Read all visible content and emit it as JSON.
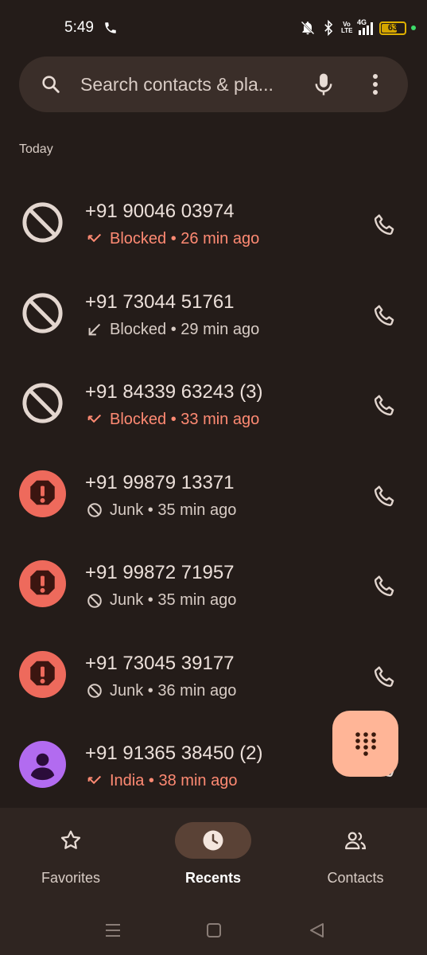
{
  "status_bar": {
    "time": "5:49",
    "volte_line1": "Vo",
    "volte_line2": "LTE",
    "network": "4G",
    "battery": "63",
    "battery_level": 0.63
  },
  "search": {
    "placeholder": "Search contacts & pla..."
  },
  "section_label": "Today",
  "calls": [
    {
      "number": "+91 90046 03974",
      "status": "Blocked • 26 min ago",
      "type": "missed",
      "avatar": "blocked",
      "color": "#ff8a73"
    },
    {
      "number": "+91 73044 51761",
      "status": "Blocked • 29 min ago",
      "type": "incoming",
      "avatar": "blocked",
      "color": "#d8ccc5"
    },
    {
      "number": "+91 84339 63243 (3)",
      "status": "Blocked • 33 min ago",
      "type": "missed",
      "avatar": "blocked",
      "color": "#ff8a73"
    },
    {
      "number": "+91 99879 13371",
      "status": "Junk • 35 min ago",
      "type": "junk",
      "avatar": "spam",
      "color": "#d8ccc5"
    },
    {
      "number": "+91 99872 71957",
      "status": "Junk • 35 min ago",
      "type": "junk",
      "avatar": "spam",
      "color": "#d8ccc5"
    },
    {
      "number": "+91 73045 39177",
      "status": "Junk • 36 min ago",
      "type": "junk",
      "avatar": "spam",
      "color": "#d8ccc5"
    },
    {
      "number": "+91 91365 38450 (2)",
      "status": "India • 38 min ago",
      "type": "missed",
      "avatar": "person",
      "color": "#ff8a73"
    }
  ],
  "nav": {
    "favorites": "Favorites",
    "recents": "Recents",
    "contacts": "Contacts"
  },
  "colors": {
    "background": "#241c19",
    "missed": "#ff8a73",
    "spam_avatar": "#ee6a5c",
    "person_avatar": "#b26bf0",
    "fab": "#ffb597",
    "active_nav": "#5a4236"
  }
}
